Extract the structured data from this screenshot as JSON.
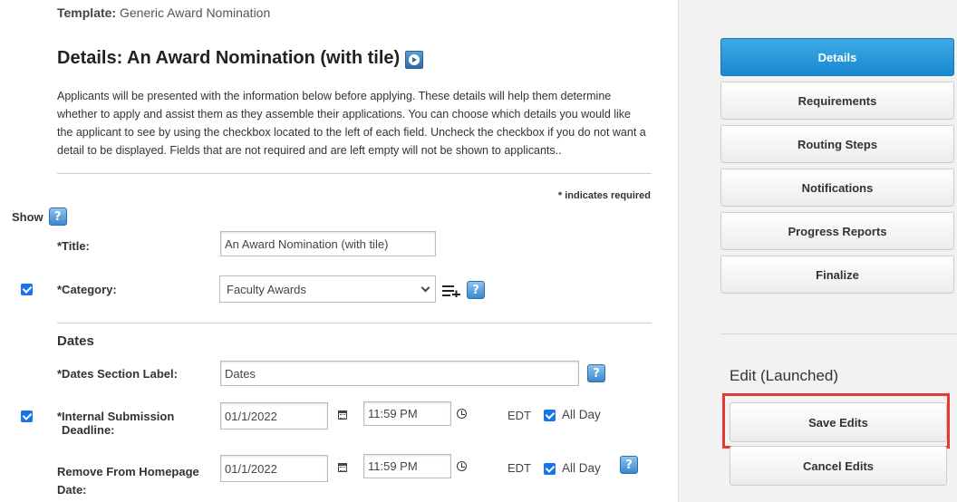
{
  "template": {
    "label": "Template:",
    "value": "Generic Award Nomination"
  },
  "page": {
    "title": "Details: An Award Nomination (with tile)",
    "intro": "Applicants will be presented with the information below before applying. These details will help them determine whether to apply and assist them as they assemble their applications. You can choose which details you would like the applicant to see by using the checkbox located to the left of each field. Uncheck the checkbox if you do not want a detail to be displayed. Fields that are not required and are left empty will not be shown to applicants..",
    "required_note": "* indicates required",
    "show_label": "Show"
  },
  "help_glyph": "?",
  "form": {
    "title_label": "*Title:",
    "title_value": "An Award Nomination (with tile)",
    "category_label": "*Category:",
    "category_value": "Faculty Awards",
    "category_checked": true,
    "dates_section": "Dates",
    "dates_label_label": "*Dates Section Label:",
    "dates_label_value": "Dates",
    "internal_deadline": {
      "label_line1": "*Internal Submission",
      "label_line2": "Deadline:",
      "date": "01/1/2022",
      "time": "11:59 PM",
      "tz": "EDT",
      "all_day": "All Day",
      "checked": true,
      "all_day_checked": true
    },
    "remove_homepage": {
      "label_line1": "Remove From Homepage",
      "label_line2": "Date:",
      "date": "01/1/2022",
      "time": "11:59 PM",
      "tz": "EDT",
      "all_day": "All Day",
      "all_day_checked": true
    }
  },
  "sidebar": {
    "nav": [
      {
        "label": "Details",
        "active": true
      },
      {
        "label": "Requirements",
        "active": false
      },
      {
        "label": "Routing Steps",
        "active": false
      },
      {
        "label": "Notifications",
        "active": false
      },
      {
        "label": "Progress Reports",
        "active": false
      },
      {
        "label": "Finalize",
        "active": false
      }
    ],
    "edit_status": "Edit (Launched)",
    "save_label": "Save Edits",
    "cancel_label": "Cancel Edits"
  },
  "colors": {
    "accent": "#1888d0",
    "highlight": "#e53935",
    "sidebar_bg": "#f2f2f2"
  }
}
